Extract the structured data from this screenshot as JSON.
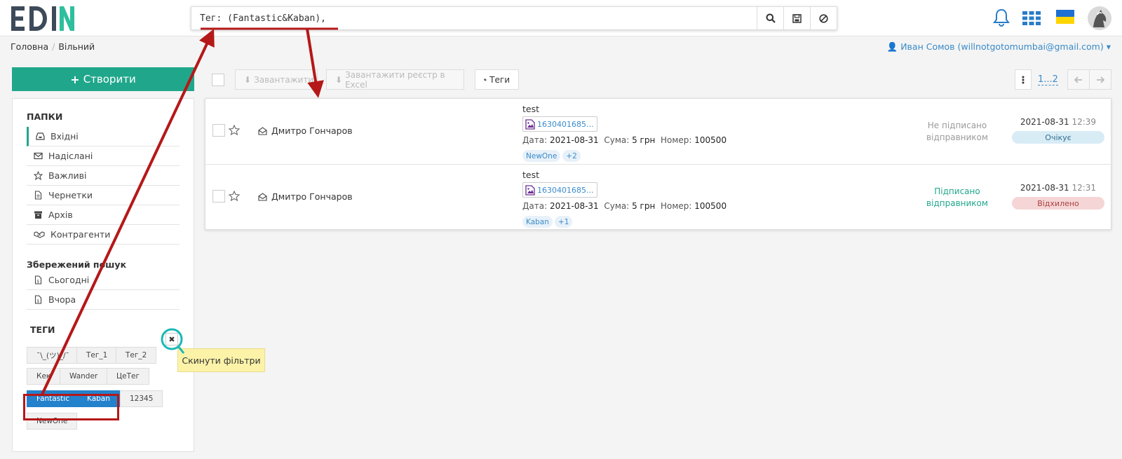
{
  "logo": {
    "text": "EDIN"
  },
  "search": {
    "value": "Тег: (Fantastic&Kaban),",
    "search_icon": "search-icon",
    "save_icon": "save-icon",
    "clear_icon": "ban-icon"
  },
  "top_icons": [
    "bell-icon",
    "apps-grid-icon",
    "ukraine-flag-icon",
    "avatar"
  ],
  "breadcrumb": [
    "Головна",
    "Вільний"
  ],
  "user": {
    "label": "Иван Сомов (willnotgotomumbai@gmail.com)"
  },
  "sidebar": {
    "create_label": "Створити",
    "folders_title": "ПАПКИ",
    "folders": [
      {
        "label": "Вхідні",
        "icon": "inbox-icon"
      },
      {
        "label": "Надіслані",
        "icon": "envelope-icon"
      },
      {
        "label": "Важливі",
        "icon": "star-icon"
      },
      {
        "label": "Чернетки",
        "icon": "document-icon"
      },
      {
        "label": "Архів",
        "icon": "archive-icon"
      },
      {
        "label": "Контрагенти",
        "icon": "handshake-icon"
      }
    ],
    "saved_title": "Збережений пошук",
    "saved": [
      {
        "label": "Сьогодні",
        "icon": "file-icon"
      },
      {
        "label": "Вчора",
        "icon": "file-icon"
      }
    ],
    "tags_title": "ТЕГИ",
    "tags": [
      "¯\\_(ツ)_/¯",
      "Тег_1",
      "Тег_2",
      "Кек",
      "Wander",
      "ЦеТег",
      "Fantastic",
      "Kaban",
      "12345",
      "NewOne"
    ],
    "selected_tags": [
      "Fantastic",
      "Kaban"
    ],
    "reset_tooltip": "Скинути фільтри"
  },
  "toolbar": {
    "download_label": "Завантажити",
    "excel_label": "Завантажити реєстр в Excel",
    "tags_label": "Теги",
    "pagination": "1...2"
  },
  "documents": [
    {
      "sender": "Дмитро Гончаров",
      "subject": "test",
      "file": "1630401685...",
      "date_label": "Дата:",
      "date": "2021-08-31",
      "sum_label": "Сума:",
      "sum": "5 грн",
      "number_label": "Номер:",
      "number": "100500",
      "tags": [
        "NewOne",
        "+2"
      ],
      "signature": "Не підписано відправником",
      "signature_color": "#9a9a9a",
      "received_date": "2021-08-31",
      "received_time": "12:39",
      "status": "Очікує",
      "status_bg": "#d8ecf6",
      "status_color": "#31708f"
    },
    {
      "sender": "Дмитро Гончаров",
      "subject": "test",
      "file": "1630401685...",
      "date_label": "Дата:",
      "date": "2021-08-31",
      "sum_label": "Сума:",
      "sum": "5 грн",
      "number_label": "Номер:",
      "number": "100500",
      "tags": [
        "Kaban",
        "+1"
      ],
      "signature": "Підписано відправником",
      "signature_color": "#20a78b",
      "received_date": "2021-08-31",
      "received_time": "12:31",
      "status": "Відхилено",
      "status_bg": "#f5d5d5",
      "status_color": "#a94442"
    }
  ],
  "colors": {
    "accent": "#20a78b",
    "link": "#3a8bc9",
    "selected_tag": "#2481cc",
    "annotation": "#b51818",
    "tooltip_bg": "#fcf3a8",
    "highlight_ring": "#1bb8b5"
  }
}
